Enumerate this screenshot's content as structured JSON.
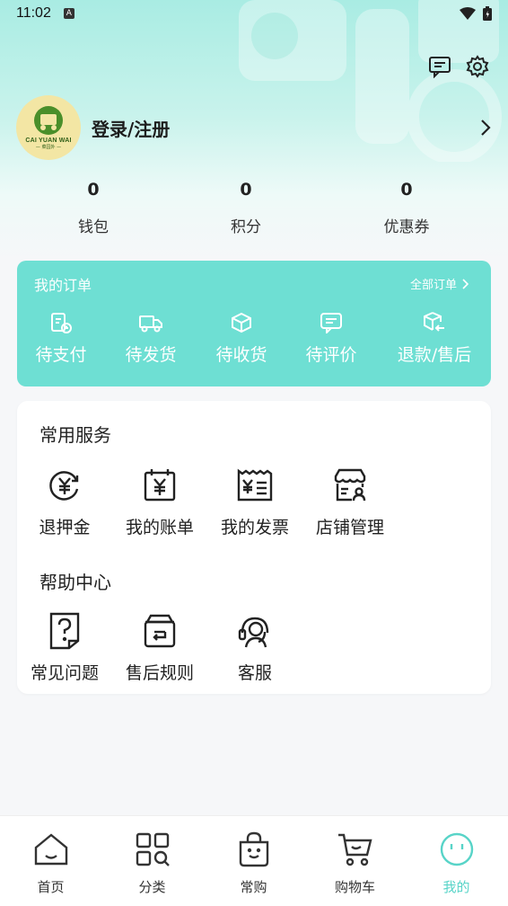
{
  "status_bar": {
    "time": "11:02",
    "notification_glyph": "A"
  },
  "colors": {
    "accent": "#6edfd3",
    "active_tab": "#58d4c8",
    "avatar_bg": "#f3e6a4"
  },
  "header": {
    "icons": [
      "message-icon",
      "settings-icon"
    ]
  },
  "profile": {
    "login_label": "登录/注册",
    "avatar_logo_text": "CAI YUAN WAI",
    "avatar_sub_text": "— 菜园外 —"
  },
  "stats": [
    {
      "value": "0",
      "label": "钱包"
    },
    {
      "value": "0",
      "label": "积分"
    },
    {
      "value": "0",
      "label": "优惠券"
    }
  ],
  "orders": {
    "title": "我的订单",
    "all_label": "全部订单",
    "items": [
      {
        "label": "待支付",
        "icon": "clipboard-clock-icon"
      },
      {
        "label": "待发货",
        "icon": "truck-icon"
      },
      {
        "label": "待收货",
        "icon": "box-icon"
      },
      {
        "label": "待评价",
        "icon": "comment-icon"
      },
      {
        "label": "退款/售后",
        "icon": "return-box-icon"
      }
    ]
  },
  "services": {
    "title": "常用服务",
    "items": [
      {
        "label": "退押金",
        "icon": "yen-refund-icon"
      },
      {
        "label": "我的账单",
        "icon": "calendar-yen-icon"
      },
      {
        "label": "我的发票",
        "icon": "invoice-icon"
      },
      {
        "label": "店铺管理",
        "icon": "store-user-icon"
      }
    ]
  },
  "help": {
    "title": "帮助中心",
    "items": [
      {
        "label": "常见问题",
        "icon": "question-doc-icon"
      },
      {
        "label": "售后规则",
        "icon": "return-rule-icon"
      },
      {
        "label": "客服",
        "icon": "headset-icon"
      }
    ]
  },
  "tabbar": [
    {
      "label": "首页",
      "icon": "home-icon",
      "active": false
    },
    {
      "label": "分类",
      "icon": "category-icon",
      "active": false
    },
    {
      "label": "常购",
      "icon": "shopping-bag-icon",
      "active": false
    },
    {
      "label": "购物车",
      "icon": "cart-icon",
      "active": false
    },
    {
      "label": "我的",
      "icon": "profile-face-icon",
      "active": true
    }
  ]
}
